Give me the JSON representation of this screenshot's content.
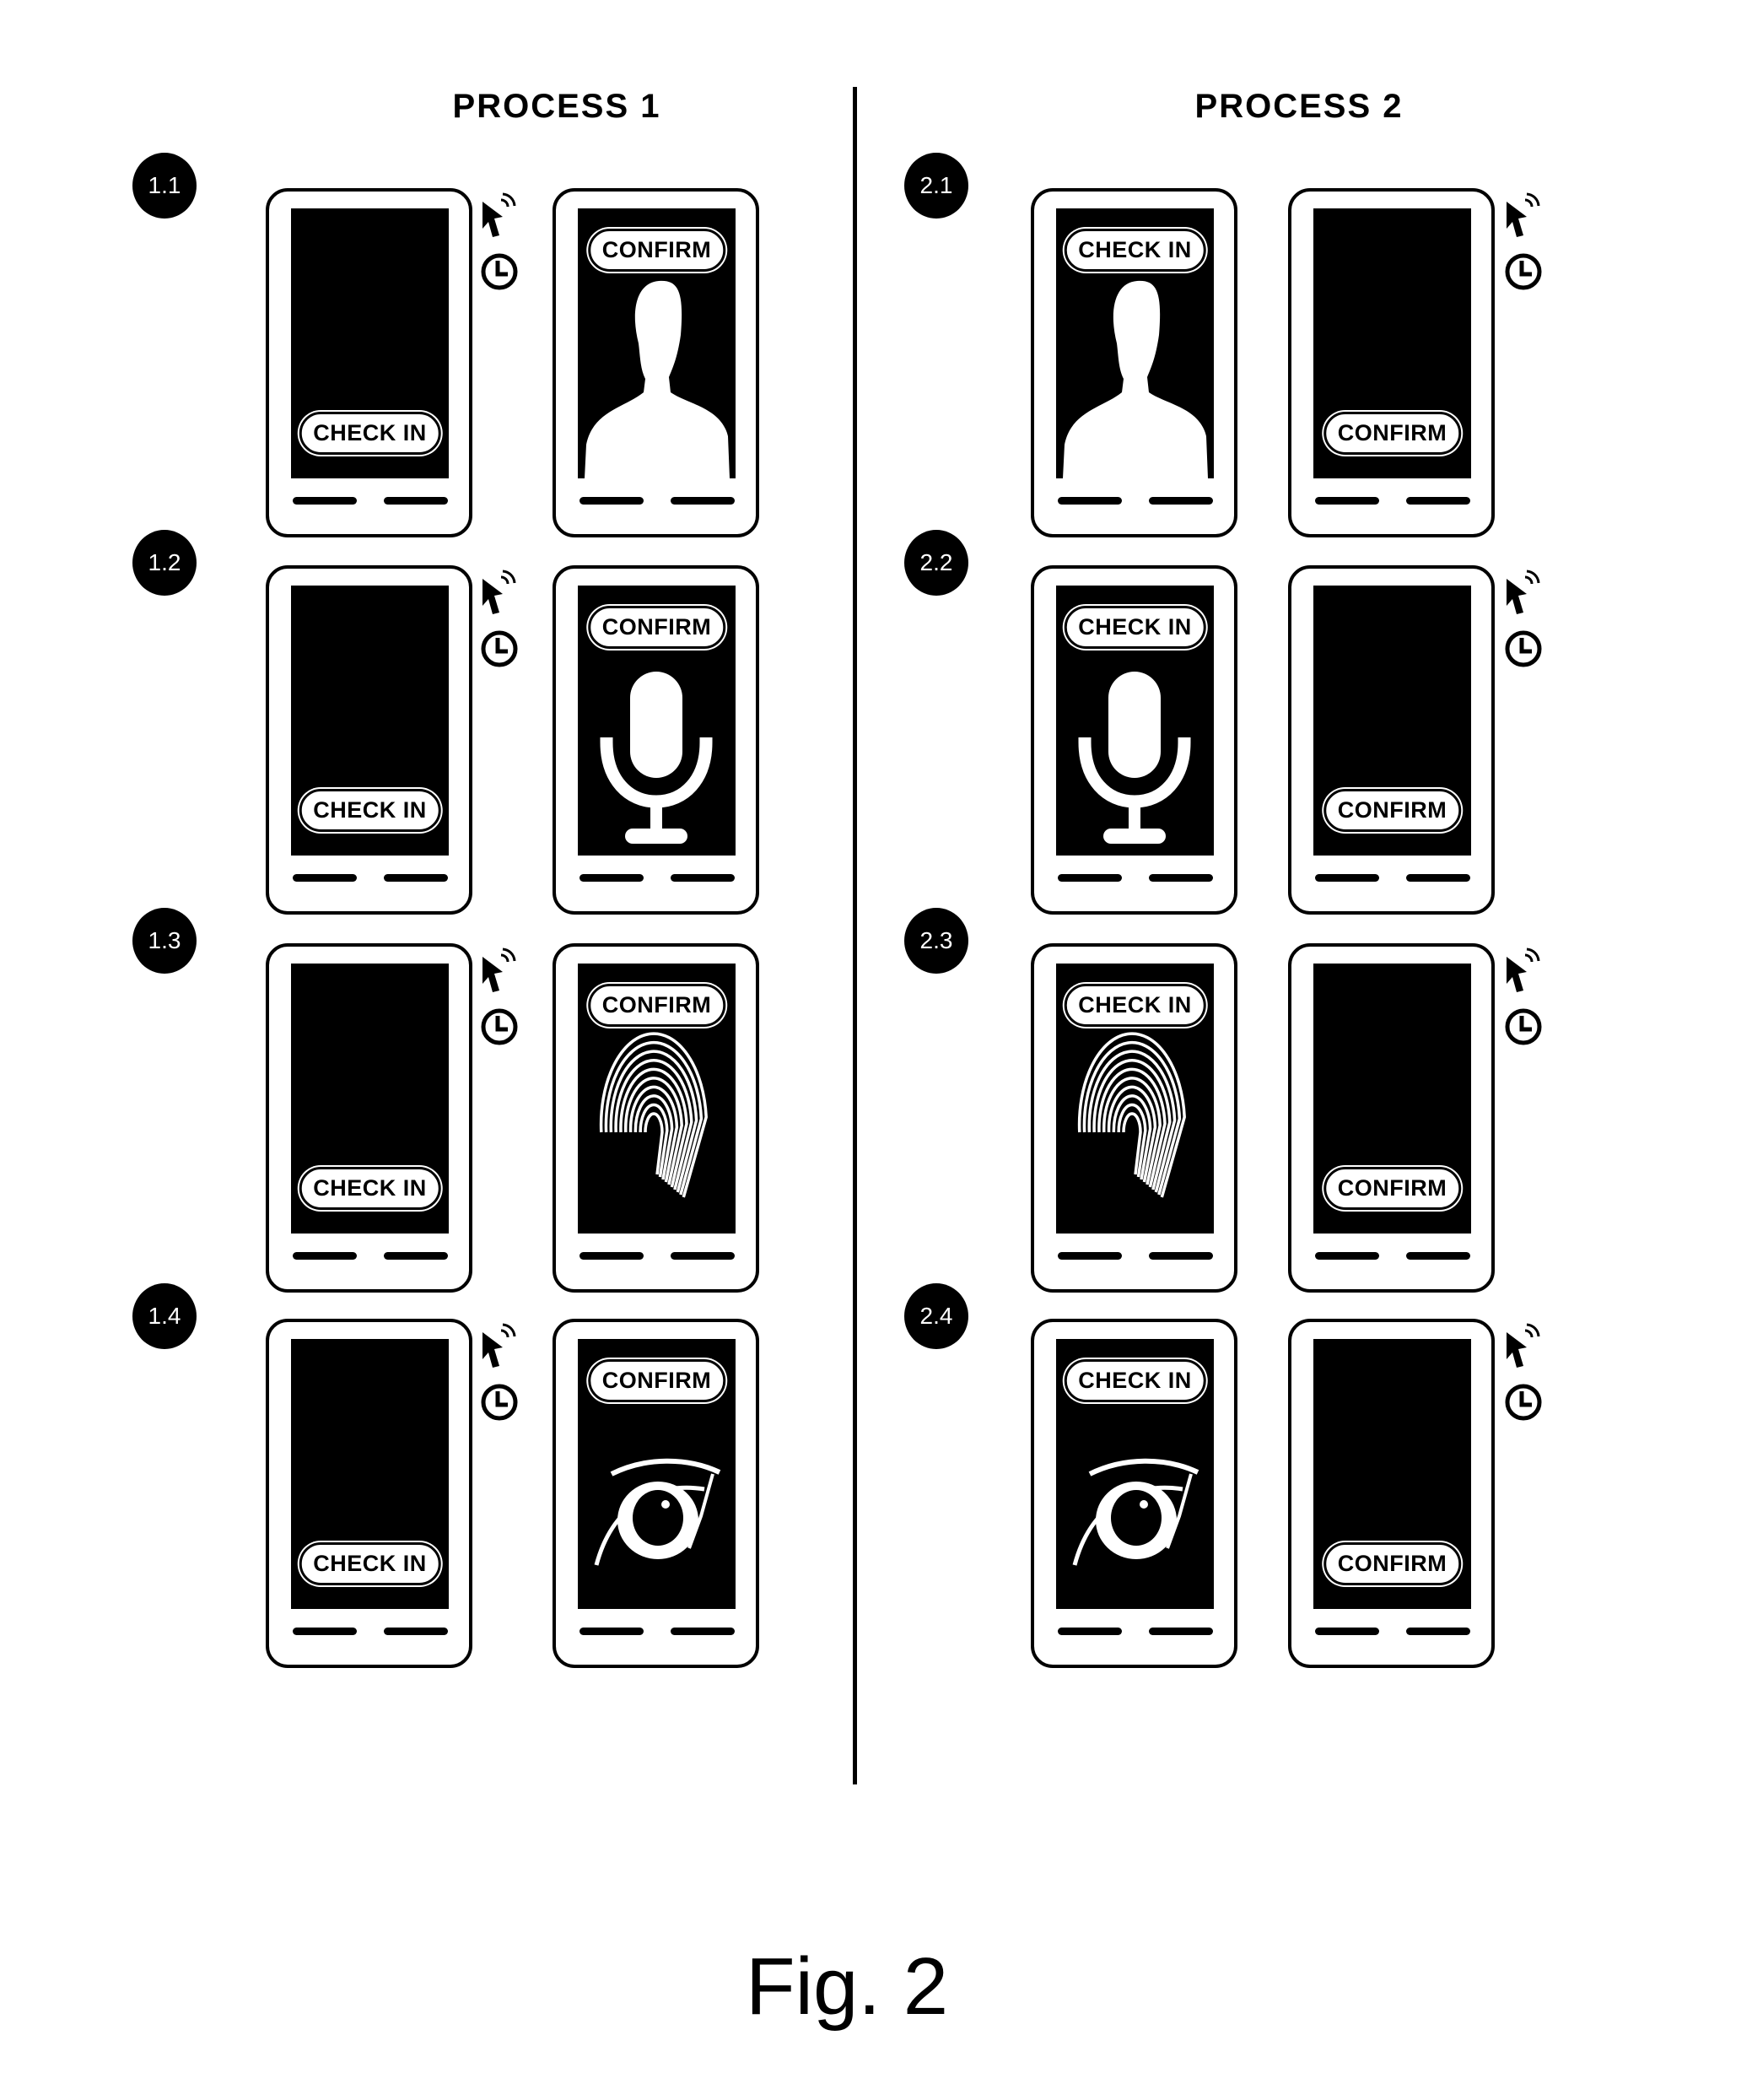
{
  "figure_caption": "Fig. 2",
  "processes": [
    {
      "title": "PROCESS 1",
      "steps": [
        {
          "label": "1.1",
          "first_phone": {
            "button": "CHECK IN",
            "button_position": "bottom",
            "biometric": "none"
          },
          "second_phone": {
            "button": "CONFIRM",
            "button_position": "top",
            "biometric": "face"
          },
          "side_icons": [
            "tap-cursor-icon",
            "clock-icon"
          ]
        },
        {
          "label": "1.2",
          "first_phone": {
            "button": "CHECK IN",
            "button_position": "bottom",
            "biometric": "none"
          },
          "second_phone": {
            "button": "CONFIRM",
            "button_position": "top",
            "biometric": "voice"
          },
          "side_icons": [
            "tap-cursor-icon",
            "clock-icon"
          ]
        },
        {
          "label": "1.3",
          "first_phone": {
            "button": "CHECK IN",
            "button_position": "bottom",
            "biometric": "none"
          },
          "second_phone": {
            "button": "CONFIRM",
            "button_position": "top",
            "biometric": "fingerprint"
          },
          "side_icons": [
            "tap-cursor-icon",
            "clock-icon"
          ]
        },
        {
          "label": "1.4",
          "first_phone": {
            "button": "CHECK IN",
            "button_position": "bottom",
            "biometric": "none"
          },
          "second_phone": {
            "button": "CONFIRM",
            "button_position": "top",
            "biometric": "eye"
          },
          "side_icons": [
            "tap-cursor-icon",
            "clock-icon"
          ]
        }
      ]
    },
    {
      "title": "PROCESS 2",
      "steps": [
        {
          "label": "2.1",
          "first_phone": {
            "button": "CHECK IN",
            "button_position": "top",
            "biometric": "face"
          },
          "second_phone": {
            "button": "CONFIRM",
            "button_position": "bottom",
            "biometric": "none"
          },
          "side_icons": [
            "tap-cursor-icon",
            "clock-icon"
          ]
        },
        {
          "label": "2.2",
          "first_phone": {
            "button": "CHECK IN",
            "button_position": "top",
            "biometric": "voice"
          },
          "second_phone": {
            "button": "CONFIRM",
            "button_position": "bottom",
            "biometric": "none"
          },
          "side_icons": [
            "tap-cursor-icon",
            "clock-icon"
          ]
        },
        {
          "label": "2.3",
          "first_phone": {
            "button": "CHECK IN",
            "button_position": "top",
            "biometric": "fingerprint"
          },
          "second_phone": {
            "button": "CONFIRM",
            "button_position": "bottom",
            "biometric": "none"
          },
          "side_icons": [
            "tap-cursor-icon",
            "clock-icon"
          ]
        },
        {
          "label": "2.4",
          "first_phone": {
            "button": "CHECK IN",
            "button_position": "top",
            "biometric": "eye"
          },
          "second_phone": {
            "button": "CONFIRM",
            "button_position": "bottom",
            "biometric": "none"
          },
          "side_icons": [
            "tap-cursor-icon",
            "clock-icon"
          ]
        }
      ]
    }
  ]
}
